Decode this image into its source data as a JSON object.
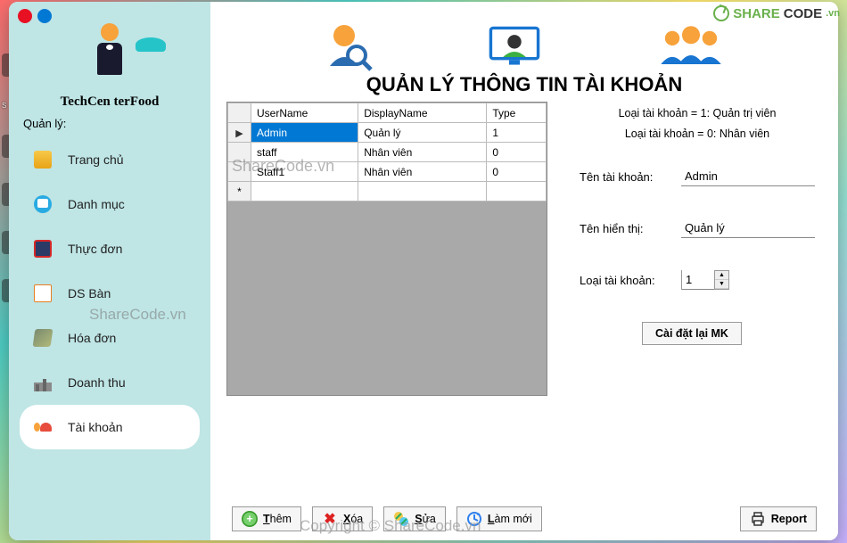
{
  "app": {
    "name": "TechCen   terFood"
  },
  "sidebar": {
    "section_label": "Quản lý:",
    "items": [
      {
        "label": "Trang chủ"
      },
      {
        "label": "Danh mục"
      },
      {
        "label": "Thực đơn"
      },
      {
        "label": "DS Bàn"
      },
      {
        "label": "Hóa đơn"
      },
      {
        "label": "Doanh thu"
      },
      {
        "label": "Tài khoản"
      }
    ],
    "active_index": 6
  },
  "page": {
    "title": "QUẢN LÝ THÔNG TIN TÀI KHOẢN"
  },
  "grid": {
    "columns": [
      "UserName",
      "DisplayName",
      "Type"
    ],
    "rows": [
      {
        "UserName": "Admin",
        "DisplayName": "Quản lý",
        "Type": "1",
        "selected": true,
        "indicator": "▶"
      },
      {
        "UserName": "staff",
        "DisplayName": "Nhân viên",
        "Type": "0"
      },
      {
        "UserName": "Staff1",
        "DisplayName": "Nhân viên",
        "Type": "0"
      }
    ],
    "new_row_indicator": "*"
  },
  "legend": {
    "line1": "Loại tài khoản = 1: Quản trị viên",
    "line2": "Loại tài khoản = 0: Nhân viên"
  },
  "form": {
    "username_label": "Tên tài khoản:",
    "username_value": "Admin",
    "display_label": "Tên hiển thị:",
    "display_value": "Quản lý",
    "type_label": "Loại tài khoản:",
    "type_value": "1",
    "reset_pw_label": "Cài đặt lại MK"
  },
  "actions": {
    "add": "Thêm",
    "delete": "Xóa",
    "edit": "Sửa",
    "refresh": "Làm mới",
    "report": "Report"
  },
  "watermarks": {
    "w1": "ShareCode.vn",
    "w2": "ShareCode.vn",
    "w3": "Copyright © ShareCode.vn",
    "logo_a": "SHARE",
    "logo_b": "CODE",
    "logo_c": ".vn"
  }
}
